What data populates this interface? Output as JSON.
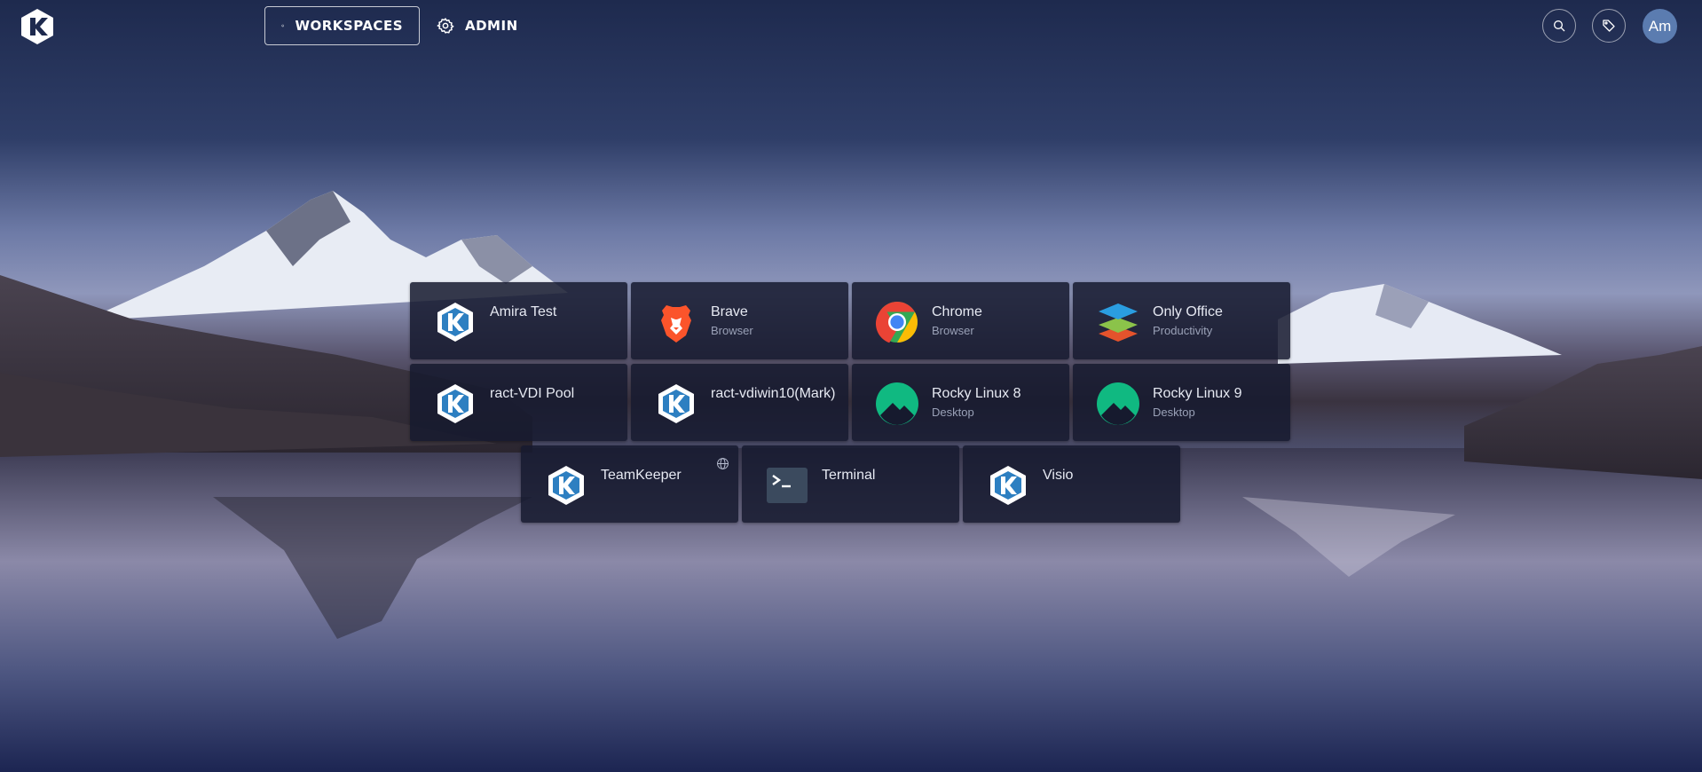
{
  "header": {
    "workspaces_label": "WORKSPACES",
    "admin_label": "ADMIN",
    "avatar_initials": "Am",
    "icons": [
      "logo-icon",
      "layers-icon",
      "gear-icon",
      "search-icon",
      "tag-icon"
    ]
  },
  "workspaces": [
    {
      "name": "Amira Test",
      "subtitle": "",
      "icon": "kasm-icon"
    },
    {
      "name": "Brave",
      "subtitle": "Browser",
      "icon": "brave-icon"
    },
    {
      "name": "Chrome",
      "subtitle": "Browser",
      "icon": "chrome-icon"
    },
    {
      "name": "Only Office",
      "subtitle": "Productivity",
      "icon": "onlyoffice-icon"
    },
    {
      "name": "ract-VDI Pool",
      "subtitle": "",
      "icon": "kasm-icon"
    },
    {
      "name": "ract-vdiwin10(Mark)",
      "subtitle": "",
      "icon": "kasm-icon"
    },
    {
      "name": "Rocky Linux 8",
      "subtitle": "Desktop",
      "icon": "rocky-icon"
    },
    {
      "name": "Rocky Linux 9",
      "subtitle": "Desktop",
      "icon": "rocky-icon"
    },
    {
      "name": "TeamKeeper",
      "subtitle": "",
      "icon": "kasm-icon",
      "badge": "globe-icon"
    },
    {
      "name": "Terminal",
      "subtitle": "",
      "icon": "terminal-icon"
    },
    {
      "name": "Visio",
      "subtitle": "",
      "icon": "kasm-icon"
    }
  ],
  "colors": {
    "tile_bg": "#161a2e",
    "avatar_bg": "#5b7cb0",
    "kasm_blue": "#2d7fc1",
    "rocky_green": "#10b981",
    "brave_orange": "#fb542b"
  }
}
